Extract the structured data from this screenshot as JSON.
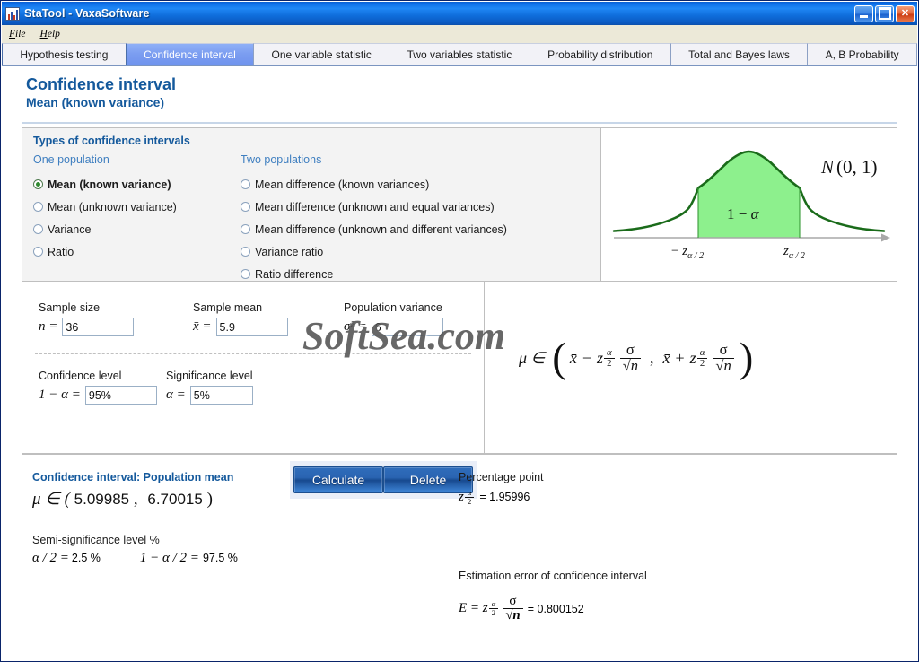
{
  "window": {
    "title": "StaTool - VaxaSoftware",
    "icon": "bar-chart-icon",
    "buttons": {
      "minimize": "_",
      "maximize": "□",
      "close": "✕"
    }
  },
  "menu": {
    "items": [
      "File",
      "Help"
    ]
  },
  "tabs": [
    {
      "label": "Hypothesis testing",
      "active": false
    },
    {
      "label": "Confidence interval",
      "active": true
    },
    {
      "label": "One variable statistic",
      "active": false
    },
    {
      "label": "Two variables statistic",
      "active": false
    },
    {
      "label": "Probability distribution",
      "active": false
    },
    {
      "label": "Total and Bayes laws",
      "active": false
    },
    {
      "label": "A, B Probability",
      "active": false
    }
  ],
  "page": {
    "title": "Confidence interval",
    "subtitle": "Mean (known variance)"
  },
  "types": {
    "title": "Types of confidence intervals",
    "one_population_header": "One population",
    "two_populations_header": "Two populations",
    "one_population": [
      {
        "label": "Mean (known variance)",
        "checked": true
      },
      {
        "label": "Mean (unknown variance)",
        "checked": false
      },
      {
        "label": "Variance",
        "checked": false
      },
      {
        "label": "Ratio",
        "checked": false
      }
    ],
    "two_populations": [
      {
        "label": "Mean difference (known variances)",
        "checked": false
      },
      {
        "label": "Mean difference (unknown and equal variances)",
        "checked": false
      },
      {
        "label": "Mean difference (unknown and different variances)",
        "checked": false
      },
      {
        "label": "Variance ratio",
        "checked": false
      },
      {
        "label": "Ratio difference",
        "checked": false
      }
    ]
  },
  "curve": {
    "distribution_label": "N(0, 1)",
    "area_label": "1 − α",
    "left_tick": "− z",
    "left_tick_sub": "α / 2",
    "right_tick": "z",
    "right_tick_sub": "α / 2",
    "fill_color": "#8df08d",
    "stroke_color": "#1a6b1a"
  },
  "inputs": {
    "sample_size": {
      "label": "Sample size",
      "symbol": "n =",
      "value": "36"
    },
    "sample_mean": {
      "label": "Sample mean",
      "symbol": "x̄ =",
      "value": "5.9"
    },
    "population_variance": {
      "label": "Population variance",
      "symbol": "σ² =",
      "value": "6"
    },
    "confidence_level": {
      "label": "Confidence level",
      "symbol": "1 − α =",
      "value": "95%"
    },
    "significance_level": {
      "label": "Significance level",
      "symbol": "α =",
      "value": "5%"
    }
  },
  "actions": {
    "calculate_label": "Calculate",
    "delete_label": "Delete"
  },
  "formula": {
    "mu_in": "μ ∈",
    "left_mean": "x̄",
    "minus": "−",
    "plus": "+",
    "z_sym": "z",
    "alpha": "α",
    "two": "2",
    "sigma": "σ",
    "sqrt_n": "√n",
    "comma": ","
  },
  "results": {
    "ci_title": "Confidence interval: Population mean",
    "ci_prefix": "μ ∈ (",
    "ci_lower": "5.09985",
    "ci_sep": ",",
    "ci_upper": "6.70015",
    "ci_suffix": ")",
    "semi_title": "Semi-significance level %",
    "semi_alpha_label": "α / 2 =",
    "semi_alpha_value": "2.5 %",
    "semi_conf_label": "1 − α / 2 =",
    "semi_conf_value": "97.5 %",
    "pct_title": "Percentage point",
    "pct_symbol": "z",
    "pct_sub_num": "α",
    "pct_sub_den": "2",
    "pct_eq": "= 1.95996",
    "err_title": "Estimation error of confidence interval",
    "err_prefix": "E = z",
    "err_sub_num": "α",
    "err_sub_den": "2",
    "err_sigma": "σ",
    "err_sqrt": "√n",
    "err_eq": "= 0.800152"
  },
  "watermark": {
    "text": "SoftSea.com"
  }
}
